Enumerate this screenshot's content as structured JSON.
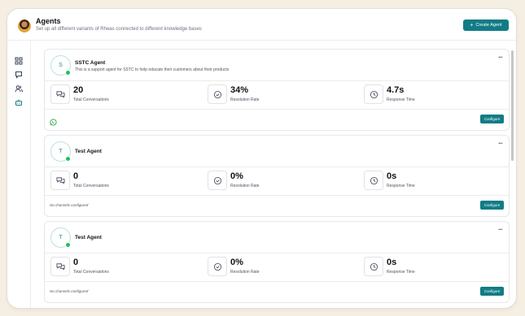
{
  "header": {
    "title": "Agents",
    "subtitle": "Set up all different variants of Rheas connected to different knowledge bases",
    "create_button": "Create Agent"
  },
  "sidebar": {
    "items": [
      {
        "icon": "dashboard-grid-icon",
        "active": false
      },
      {
        "icon": "chat-bubble-icon",
        "active": false
      },
      {
        "icon": "users-icon",
        "active": false
      },
      {
        "icon": "bot-icon",
        "active": true
      }
    ]
  },
  "agents": [
    {
      "initial": "S",
      "name": "SSTC Agent",
      "description": "This is a support agent for SSTC to help educate their customers about their products",
      "stats": {
        "conversations": {
          "value": "20",
          "label": "Total Conversations"
        },
        "resolution": {
          "value": "34%",
          "label": "Resolution Rate"
        },
        "response": {
          "value": "4.7s",
          "label": "Response Time"
        }
      },
      "channels_text": "",
      "channel_icons": [
        "whatsapp-icon"
      ],
      "configure": "Configure"
    },
    {
      "initial": "T",
      "name": "Test Agent",
      "description": "",
      "stats": {
        "conversations": {
          "value": "0",
          "label": "Total Conversations"
        },
        "resolution": {
          "value": "0%",
          "label": "Resolution Rate"
        },
        "response": {
          "value": "0s",
          "label": "Response Time"
        }
      },
      "channels_text": "No channels configured",
      "channel_icons": [],
      "configure": "Configure"
    },
    {
      "initial": "T",
      "name": "Test Agent",
      "description": "",
      "stats": {
        "conversations": {
          "value": "0",
          "label": "Total Conversations"
        },
        "resolution": {
          "value": "0%",
          "label": "Resolution Rate"
        },
        "response": {
          "value": "0s",
          "label": "Response Time"
        }
      },
      "channels_text": "No channels configured",
      "channel_icons": [],
      "configure": "Configure"
    }
  ],
  "colors": {
    "accent": "#117c86",
    "online": "#21c063",
    "background": "#f4eee3"
  }
}
